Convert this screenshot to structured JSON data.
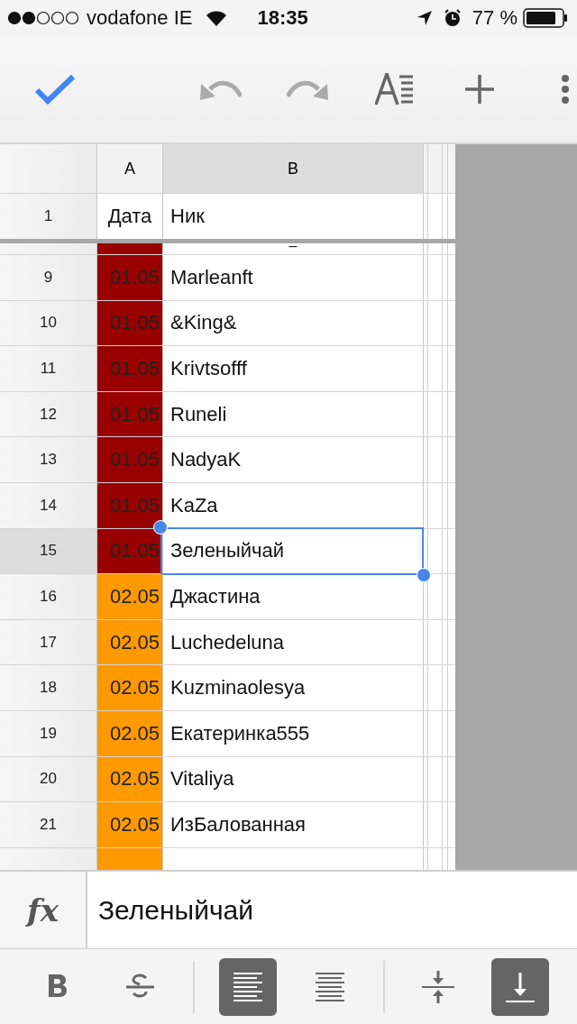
{
  "status_bar": {
    "carrier": "vodafone IE",
    "time": "18:35",
    "battery": "77 %"
  },
  "columns": [
    {
      "label": "A",
      "selected": false
    },
    {
      "label": "B",
      "selected": true
    }
  ],
  "header_row": {
    "number": "1",
    "cells": [
      "Дата",
      "Ник"
    ]
  },
  "frozen_gap": {
    "mark": "–"
  },
  "rows": [
    {
      "number": "9",
      "date": "01.05",
      "color": "#990000",
      "nick": "Marleanft",
      "selected": false
    },
    {
      "number": "10",
      "date": "01.05",
      "color": "#990000",
      "nick": "&King&",
      "selected": false
    },
    {
      "number": "11",
      "date": "01.05",
      "color": "#990000",
      "nick": "Krivtsofff",
      "selected": false
    },
    {
      "number": "12",
      "date": "01.05",
      "color": "#990000",
      "nick": "Runeli",
      "selected": false
    },
    {
      "number": "13",
      "date": "01.05",
      "color": "#990000",
      "nick": "NadyaK",
      "selected": false
    },
    {
      "number": "14",
      "date": "01.05",
      "color": "#990000",
      "nick": "KaZa",
      "selected": false
    },
    {
      "number": "15",
      "date": "01.05",
      "color": "#990000",
      "nick": "Зеленыйчай",
      "selected": true
    },
    {
      "number": "16",
      "date": "02.05",
      "color": "#ff9900",
      "nick": "Джастина",
      "selected": false
    },
    {
      "number": "17",
      "date": "02.05",
      "color": "#ff9900",
      "nick": "Luchedeluna",
      "selected": false
    },
    {
      "number": "18",
      "date": "02.05",
      "color": "#ff9900",
      "nick": "Kuzminaolesya",
      "selected": false
    },
    {
      "number": "19",
      "date": "02.05",
      "color": "#ff9900",
      "nick": "Екатеринка555",
      "selected": false
    },
    {
      "number": "20",
      "date": "02.05",
      "color": "#ff9900",
      "nick": "Vitaliya",
      "selected": false
    },
    {
      "number": "21",
      "date": "02.05",
      "color": "#ff9900",
      "nick": "ИзБалованная",
      "selected": false
    }
  ],
  "formula_bar": {
    "icon": "fx",
    "value": "Зеленыйчай"
  },
  "format_tools": [
    {
      "kind": "bold",
      "selected": false
    },
    {
      "kind": "strike",
      "selected": false
    },
    {
      "kind": "divider"
    },
    {
      "kind": "align-left",
      "selected": true
    },
    {
      "kind": "align-center",
      "selected": false
    },
    {
      "kind": "divider"
    },
    {
      "kind": "valign-middle",
      "selected": false
    },
    {
      "kind": "valign-bottom",
      "selected": true
    }
  ]
}
